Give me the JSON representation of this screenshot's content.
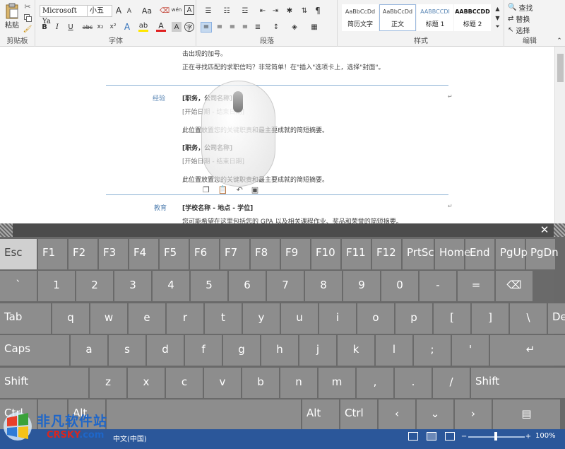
{
  "ribbon": {
    "clipboard": {
      "paste_label": "粘贴",
      "group_label": "剪贴板"
    },
    "font": {
      "font_name": "Microsoft Ya",
      "font_size": "小五",
      "group_label": "字体",
      "bold": "B",
      "italic": "I",
      "underline": "U",
      "strike": "abc",
      "subscript": "x₂",
      "superscript": "x²",
      "change_case": "Aa",
      "grow": "A",
      "shrink": "A",
      "phonetic": "wén",
      "char_border": "A"
    },
    "paragraph": {
      "group_label": "段落"
    },
    "styles": {
      "group_label": "样式",
      "items": [
        {
          "preview": "AaBbCcDd",
          "name": "简历文字"
        },
        {
          "preview": "AaBbCcDd",
          "name": "正文"
        },
        {
          "preview": "AABBCCDI",
          "name": "标题 1"
        },
        {
          "preview": "AABBCCDD",
          "name": "标题 2"
        }
      ]
    },
    "editing": {
      "find": "查找",
      "replace": "替换",
      "select": "选择",
      "group_label": "编辑"
    }
  },
  "document": {
    "line1": "击出现的加号。",
    "line2": "正在寻找匹配的求职信吗？非常简单！在\"插入\"选项卡上，选择\"封面\"。",
    "experience_label": "经验",
    "job1_title": "[职务，公司名称]",
    "job1_dates": "[开始日期 - 结束日期]",
    "job1_desc": "此位置放置您的关键职责和最主要成就的简短摘要。",
    "job2_title": "[职务，公司名称]",
    "job2_dates": "[开始日期 - 结束日期]",
    "job2_desc": "此位置放置您的关键职责和最主要成就的简短摘要。",
    "education_label": "教育",
    "school": "[学校名称 - 地点 - 学位]",
    "school_desc": "您可能希望在这里包括您的 GPA 以及相关课程作业、奖品和荣誉的简短摘要。"
  },
  "keyboard": {
    "close_glyph": "✕",
    "rows": [
      [
        "Esc",
        "F1",
        "F2",
        "F3",
        "F4",
        "F5",
        "F6",
        "F7",
        "F8",
        "F9",
        "F10",
        "F11",
        "F12",
        "PrtSc",
        "Home",
        "End",
        "PgUp",
        "PgDn"
      ],
      [
        "`",
        "1",
        "2",
        "3",
        "4",
        "5",
        "6",
        "7",
        "8",
        "9",
        "0",
        "-",
        "=",
        "⌫"
      ],
      [
        "Tab",
        "q",
        "w",
        "e",
        "r",
        "t",
        "y",
        "u",
        "i",
        "o",
        "p",
        "[",
        "]",
        "\\",
        "Del"
      ],
      [
        "Caps",
        "a",
        "s",
        "d",
        "f",
        "g",
        "h",
        "j",
        "k",
        "l",
        ";",
        "'",
        "↵"
      ],
      [
        "Shift",
        "z",
        "x",
        "c",
        "v",
        "b",
        "n",
        "m",
        ",",
        ".",
        "/",
        "Shift"
      ],
      [
        "Ctrl",
        "",
        "Alt",
        "",
        "Alt",
        "Ctrl",
        "‹",
        "⌄",
        "›",
        "▤"
      ]
    ],
    "shift_glyphs": [
      "~",
      "!",
      "@",
      "#",
      "$",
      "%",
      "^",
      "&",
      "*",
      "(",
      ")",
      "_",
      "+"
    ]
  },
  "status": {
    "language": "中文(中国)",
    "zoom": "100%"
  },
  "watermark": {
    "cn": "非凡软件站",
    "en": "CRSKY",
    "dom": ".com"
  },
  "colors": {
    "accent": "#2b579a",
    "heading": "#5b87b5",
    "rule": "#8ab0d4"
  }
}
